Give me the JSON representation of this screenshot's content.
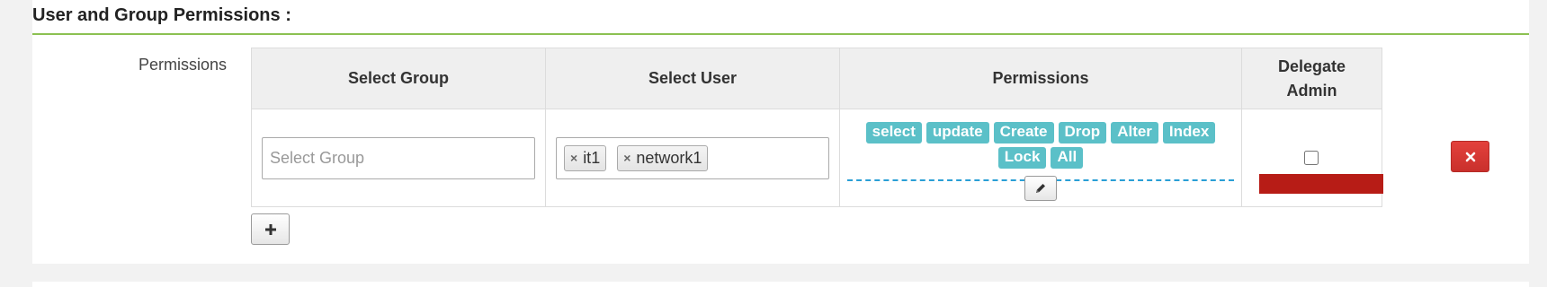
{
  "section": {
    "title": "User and Group Permissions :"
  },
  "row_label": "Permissions",
  "table": {
    "headers": {
      "group": "Select Group",
      "user": "Select User",
      "permissions": "Permissions",
      "delegate": "Delegate Admin"
    },
    "row": {
      "group_placeholder": "Select Group",
      "users": [
        "it1",
        "network1"
      ],
      "permissions": [
        "select",
        "update",
        "Create",
        "Drop",
        "Alter",
        "Index",
        "Lock",
        "All"
      ],
      "delegate_admin_checked": false
    }
  },
  "icons": {
    "remove_chip": "×",
    "edit": "pencil-icon",
    "delete": "close-icon",
    "add": "plus-icon"
  },
  "colors": {
    "accent_rule": "#8cc152",
    "tag": "#5bc0c8",
    "danger": "#c9302c",
    "error_bar": "#b71c16"
  }
}
